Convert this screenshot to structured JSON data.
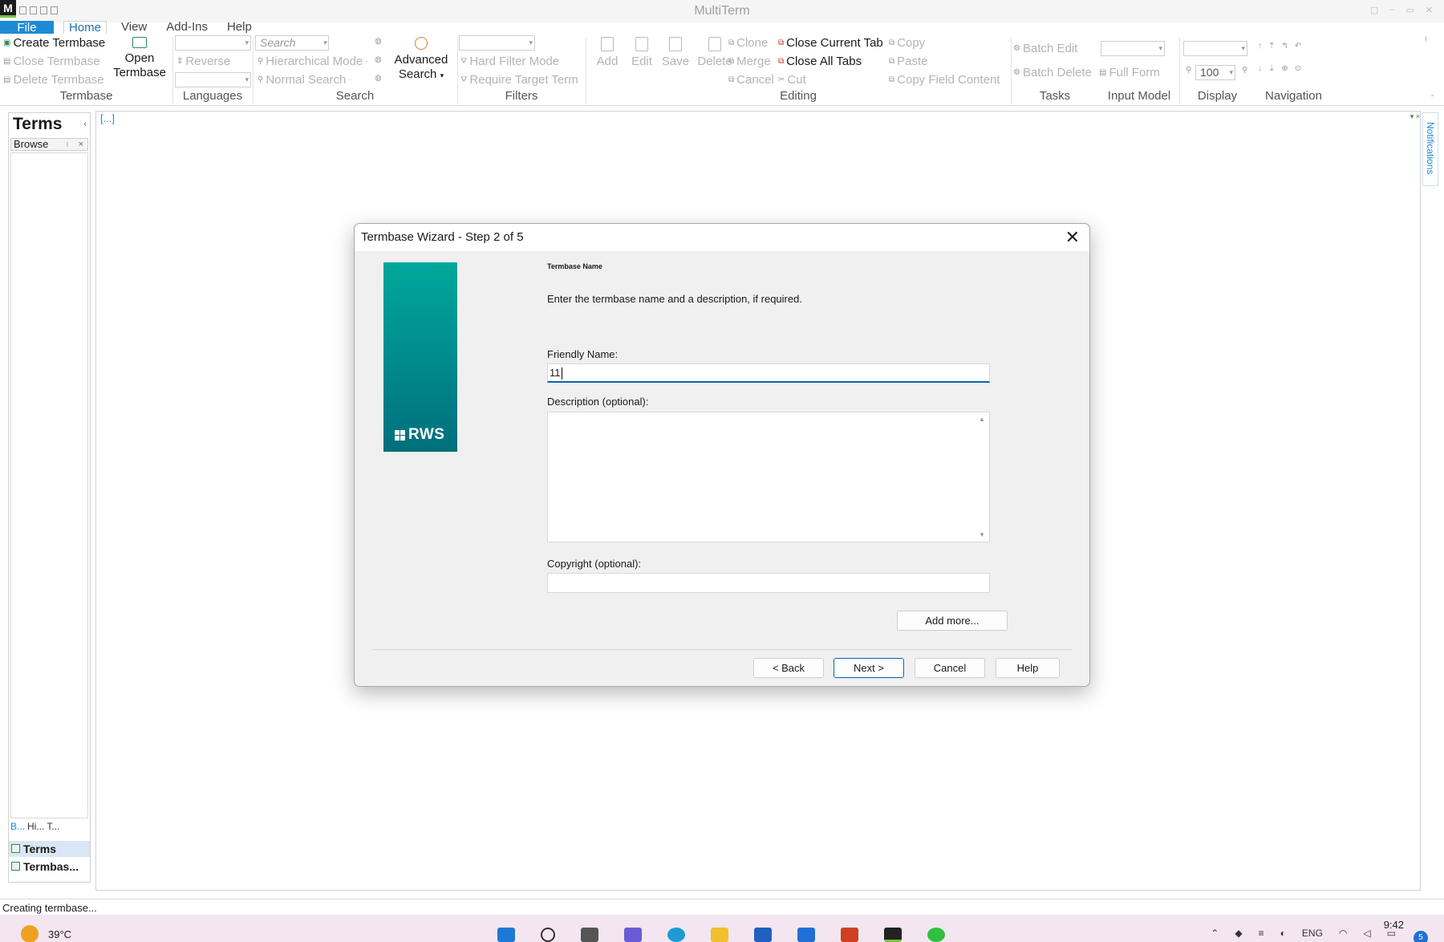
{
  "app": {
    "title": "MultiTerm",
    "logo_letter": "M"
  },
  "menu": {
    "file": "File",
    "home": "Home",
    "view": "View",
    "addins": "Add-Ins",
    "help": "Help"
  },
  "ribbon": {
    "termbase": {
      "label": "Termbase",
      "create": "Create Termbase",
      "close": "Close Termbase",
      "delete": "Delete Termbase",
      "open_line1": "Open",
      "open_line2": "Termbase"
    },
    "languages": {
      "label": "Languages",
      "reverse": "Reverse"
    },
    "search": {
      "label": "Search",
      "placeholder": "Search",
      "hierarchical": "Hierarchical Mode",
      "normal": "Normal Search",
      "advanced_line1": "Advanced",
      "advanced_line2": "Search"
    },
    "filters": {
      "label": "Filters",
      "hard_filter": "Hard Filter Mode",
      "require_target": "Require Target Term"
    },
    "editing": {
      "label": "Editing",
      "add": "Add",
      "edit": "Edit",
      "save": "Save",
      "delete": "Delete",
      "clone": "Clone",
      "merge": "Merge",
      "cancel": "Cancel",
      "close_current_tab": "Close Current Tab",
      "close_all_tabs": "Close All Tabs",
      "cut": "Cut",
      "copy": "Copy",
      "paste": "Paste",
      "copy_field_content": "Copy Field Content"
    },
    "tasks": {
      "label": "Tasks",
      "batch_edit": "Batch Edit",
      "batch_delete": "Batch Delete"
    },
    "input_model": {
      "label": "Input Model",
      "full_form": "Full Form"
    },
    "display": {
      "label": "Display",
      "zoom": "100"
    },
    "navigation": {
      "label": "Navigation"
    }
  },
  "left_panel": {
    "title": "Terms",
    "tab": "Browse",
    "mini_tabs": [
      "B...",
      "Hi...",
      "T..."
    ],
    "nav_items": [
      "Terms",
      "Termbas..."
    ]
  },
  "doc": {
    "tab": "[...]",
    "notifications": "Notifications"
  },
  "dialog": {
    "title": "Termbase Wizard - Step 2 of 5",
    "logo_text": "RWS",
    "section": "Termbase Name",
    "instruction": "Enter the termbase name and a description, if required.",
    "friendly_name_label": "Friendly Name:",
    "friendly_name_value": "11",
    "description_label": "Description (optional):",
    "copyright_label": "Copyright (optional):",
    "add_more": "Add more...",
    "back": "< Back",
    "next": "Next >",
    "cancel": "Cancel",
    "help": "Help"
  },
  "status": {
    "text": "Creating termbase..."
  },
  "taskbar": {
    "temperature": "39°C",
    "lang": "ENG",
    "time": "9:42",
    "notification_count": "5"
  },
  "colors": {
    "accent": "#1e8ad6",
    "banner_top": "#00a89a",
    "banner_bottom": "#006f7c",
    "taskbar": "#f3e6f0"
  }
}
